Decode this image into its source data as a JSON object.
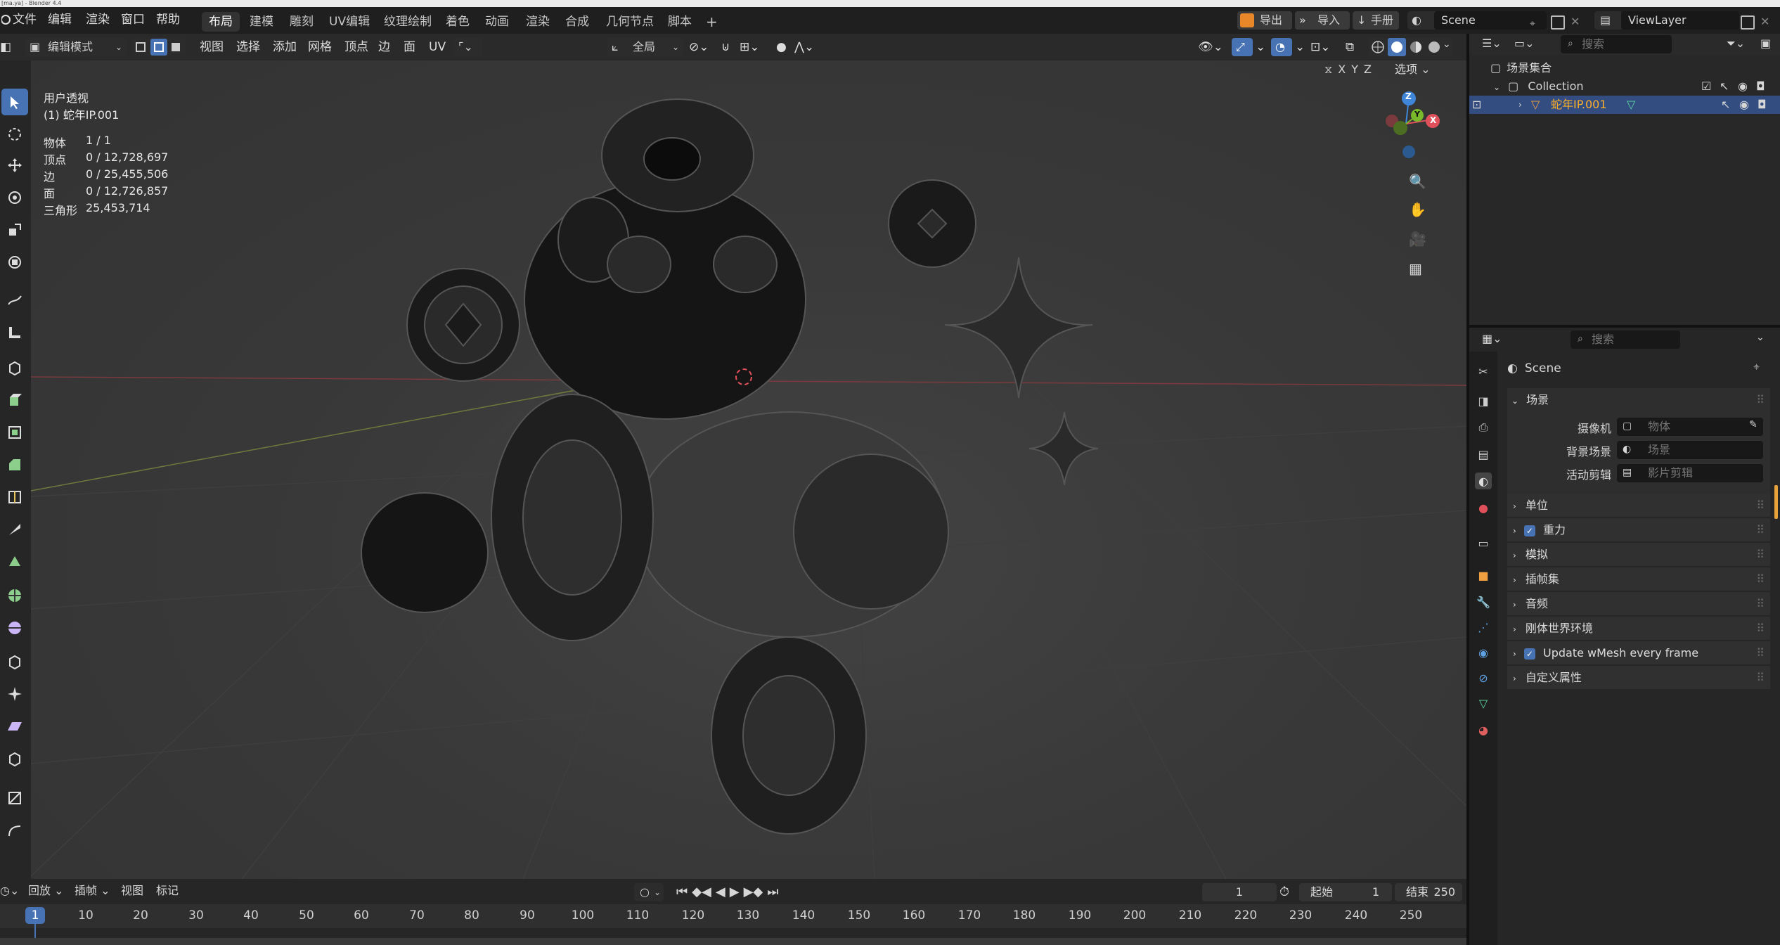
{
  "window_title": "[ma.ya] - Blender 4.4",
  "menu": {
    "items": [
      "文件",
      "编辑",
      "渲染",
      "窗口",
      "帮助"
    ]
  },
  "workspaces": {
    "tabs": [
      "布局",
      "建模",
      "雕刻",
      "UV编辑",
      "纹理绘制",
      "着色",
      "动画",
      "渲染",
      "合成",
      "几何节点",
      "脚本"
    ],
    "active": "布局",
    "add": "+"
  },
  "top_right": {
    "export": "导出",
    "import": "导入",
    "manual": "手册",
    "scene": "Scene",
    "view_layer": "ViewLayer"
  },
  "viewport_header": {
    "mode": "编辑模式",
    "menus": [
      "视图",
      "选择",
      "添加",
      "网格",
      "顶点",
      "边",
      "面",
      "UV"
    ],
    "transform_orientation": "全局",
    "axes": [
      "X",
      "Y",
      "Z"
    ],
    "options": "选项"
  },
  "overlay": {
    "view_name": "用户透视",
    "object_name": "(1) 蛇年IP.001",
    "stats": [
      {
        "label": "物体",
        "value": "1 / 1"
      },
      {
        "label": "顶点",
        "value": "0 / 12,728,697"
      },
      {
        "label": "边",
        "value": "0 / 25,455,506"
      },
      {
        "label": "面",
        "value": "0 / 12,726,857"
      },
      {
        "label": "三角形",
        "value": "25,453,714"
      }
    ]
  },
  "gizmo": {
    "z": "Z",
    "y": "Y",
    "x": "X"
  },
  "outliner": {
    "search_placeholder": "搜索",
    "root": "场景集合",
    "collection": "Collection",
    "object": "蛇年IP.001"
  },
  "properties": {
    "search_placeholder": "搜索",
    "scene_title": "Scene",
    "scene_panel": "场景",
    "fields": [
      {
        "label": "摄像机",
        "placeholder": "物体"
      },
      {
        "label": "背景场景",
        "placeholder": "场景"
      },
      {
        "label": "活动剪辑",
        "placeholder": "影片剪辑"
      }
    ],
    "panels": [
      {
        "label": "单位",
        "checkbox": false
      },
      {
        "label": "重力",
        "checkbox": true
      },
      {
        "label": "模拟",
        "checkbox": false
      },
      {
        "label": "插帧集",
        "checkbox": false
      },
      {
        "label": "音频",
        "checkbox": false
      },
      {
        "label": "刚体世界环境",
        "checkbox": false
      },
      {
        "label": "Update wMesh every frame",
        "checkbox": true
      },
      {
        "label": "自定义属性",
        "checkbox": false
      }
    ]
  },
  "timeline": {
    "menus": [
      "回放",
      "插帧",
      "视图",
      "标记"
    ],
    "current_frame": "1",
    "start_label": "起始",
    "start": "1",
    "end_label": "结束",
    "end": "250",
    "ticks": [
      "1",
      "10",
      "20",
      "30",
      "40",
      "50",
      "60",
      "70",
      "80",
      "90",
      "100",
      "110",
      "120",
      "130",
      "140",
      "150",
      "160",
      "170",
      "180",
      "190",
      "200",
      "210",
      "220",
      "230",
      "240",
      "250"
    ]
  },
  "colors": {
    "accent": "#4772b3",
    "highlight_text": "#ffaf29",
    "axis_x": "#e0505a",
    "axis_y": "#7ab82c",
    "axis_z": "#3f86d9"
  }
}
